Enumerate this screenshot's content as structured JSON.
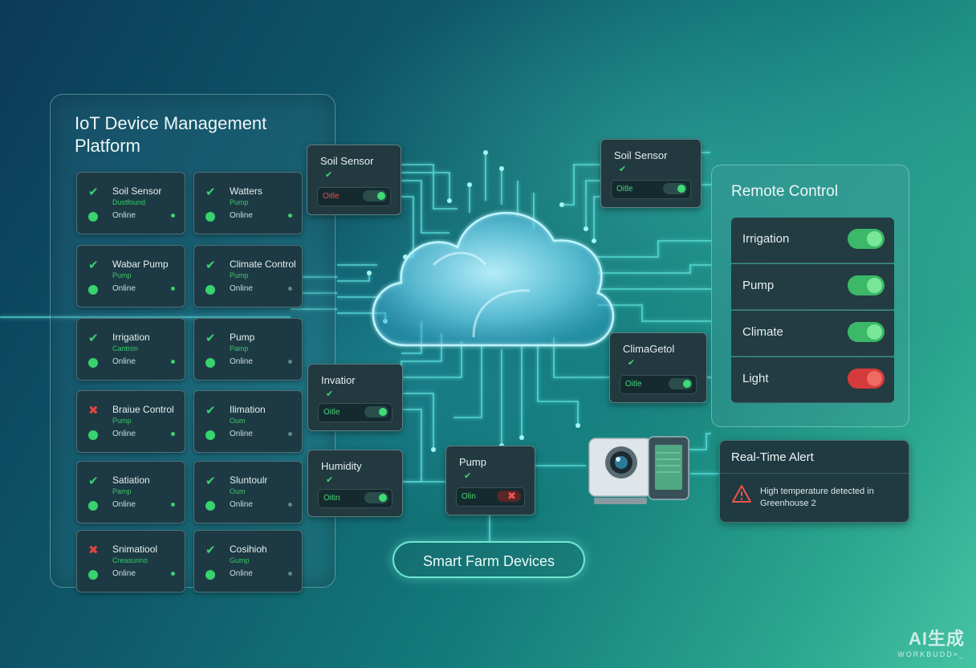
{
  "platform": {
    "title": "IoT Device Management Platform",
    "devices": [
      {
        "name": "Soil Sensor",
        "sub": "Dustfound",
        "status": "Online",
        "check": "ok",
        "dot": "on"
      },
      {
        "name": "Watters",
        "sub": "Pump",
        "status": "Online",
        "check": "ok",
        "dot": "on"
      },
      {
        "name": "Wabar Pump",
        "sub": "Pump",
        "status": "Online",
        "check": "ok",
        "dot": "on"
      },
      {
        "name": "Climate Control",
        "sub": "Pump",
        "status": "Online",
        "check": "ok",
        "dot": "dim"
      },
      {
        "name": "Irrigation",
        "sub": "Cantron",
        "status": "Online",
        "check": "ok",
        "dot": "on"
      },
      {
        "name": "Pump",
        "sub": "Pamp",
        "status": "Online",
        "check": "ok",
        "dot": "dim"
      },
      {
        "name": "Braiue Control",
        "sub": "Pump",
        "status": "Online",
        "check": "err",
        "dot": "on"
      },
      {
        "name": "Ilimation",
        "sub": "Oum",
        "status": "Online",
        "check": "ok",
        "dot": "dim"
      },
      {
        "name": "Satiation",
        "sub": "Pamp",
        "status": "Online",
        "check": "ok",
        "dot": "on"
      },
      {
        "name": "Sluntoulr",
        "sub": "Oum",
        "status": "Online",
        "check": "ok",
        "dot": "dim"
      },
      {
        "name": "Snimatiool",
        "sub": "Creasunno",
        "status": "Online",
        "check": "err",
        "dot": "on"
      },
      {
        "name": "Cosihioh",
        "sub": "Gump",
        "status": "Online",
        "check": "ok",
        "dot": "dim"
      }
    ]
  },
  "network_nodes": [
    {
      "title": "Soil Sensor",
      "state": "Oitle",
      "state_color": "red",
      "toggle": "on"
    },
    {
      "title": "Soil Sensor",
      "state": "Oitle",
      "state_color": "green",
      "toggle": "on"
    },
    {
      "title": "ClimaGetol",
      "state": "Oitle",
      "state_color": "green",
      "toggle": "on"
    },
    {
      "title": "Invatior",
      "state": "Oitle",
      "state_color": "green",
      "toggle": "on"
    },
    {
      "title": "Humidity",
      "state": "Oitin",
      "state_color": "green",
      "toggle": "on"
    },
    {
      "title": "Pump",
      "state": "Olin",
      "state_color": "green",
      "toggle": "error"
    }
  ],
  "check_glyph": "✔",
  "remote_control": {
    "title": "Remote Control",
    "controls": [
      {
        "label": "Irrigation",
        "on": true
      },
      {
        "label": "Pump",
        "on": true
      },
      {
        "label": "Climate",
        "on": true
      },
      {
        "label": "Light",
        "on": false
      }
    ]
  },
  "alert": {
    "title": "Real-Time Alert",
    "message": "High temperature detected in Greenhouse 2",
    "icon": "warning-triangle-icon"
  },
  "smart_farm_button": "Smart Farm Devices",
  "brand": {
    "line1": "AI生成",
    "line2": "WORKBUDD>_"
  },
  "colors": {
    "ok": "#39d36f",
    "error": "#e0453f",
    "accent": "#6fe7d2"
  }
}
